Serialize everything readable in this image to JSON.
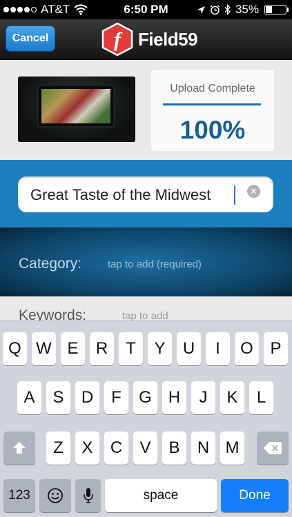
{
  "status_bar": {
    "carrier": "AT&T",
    "time": "6:50 PM",
    "battery": "35%",
    "battery_level": 0.35,
    "signal_bars": 4
  },
  "nav": {
    "cancel_label": "Cancel",
    "logo_letter": "f",
    "app_name": "Field59"
  },
  "upload": {
    "status_label": "Upload Complete",
    "percent": "100%",
    "progress": 1.0
  },
  "title_field": {
    "value": "Great Taste of the Midwest"
  },
  "category": {
    "label": "Category:",
    "hint": "tap to add (required)"
  },
  "keywords": {
    "label": "Keywords:",
    "hint": "tap to add"
  },
  "keyboard": {
    "row1": [
      "Q",
      "W",
      "E",
      "R",
      "T",
      "Y",
      "U",
      "I",
      "O",
      "P"
    ],
    "row2": [
      "A",
      "S",
      "D",
      "F",
      "G",
      "H",
      "J",
      "K",
      "L"
    ],
    "row3": [
      "Z",
      "X",
      "C",
      "V",
      "B",
      "N",
      "M"
    ],
    "numbers_key": "123",
    "space_key": "space",
    "done_key": "Done"
  },
  "colors": {
    "accent_blue": "#1e7fbe",
    "done_blue": "#157efb",
    "logo_red": "#e23b3b"
  }
}
